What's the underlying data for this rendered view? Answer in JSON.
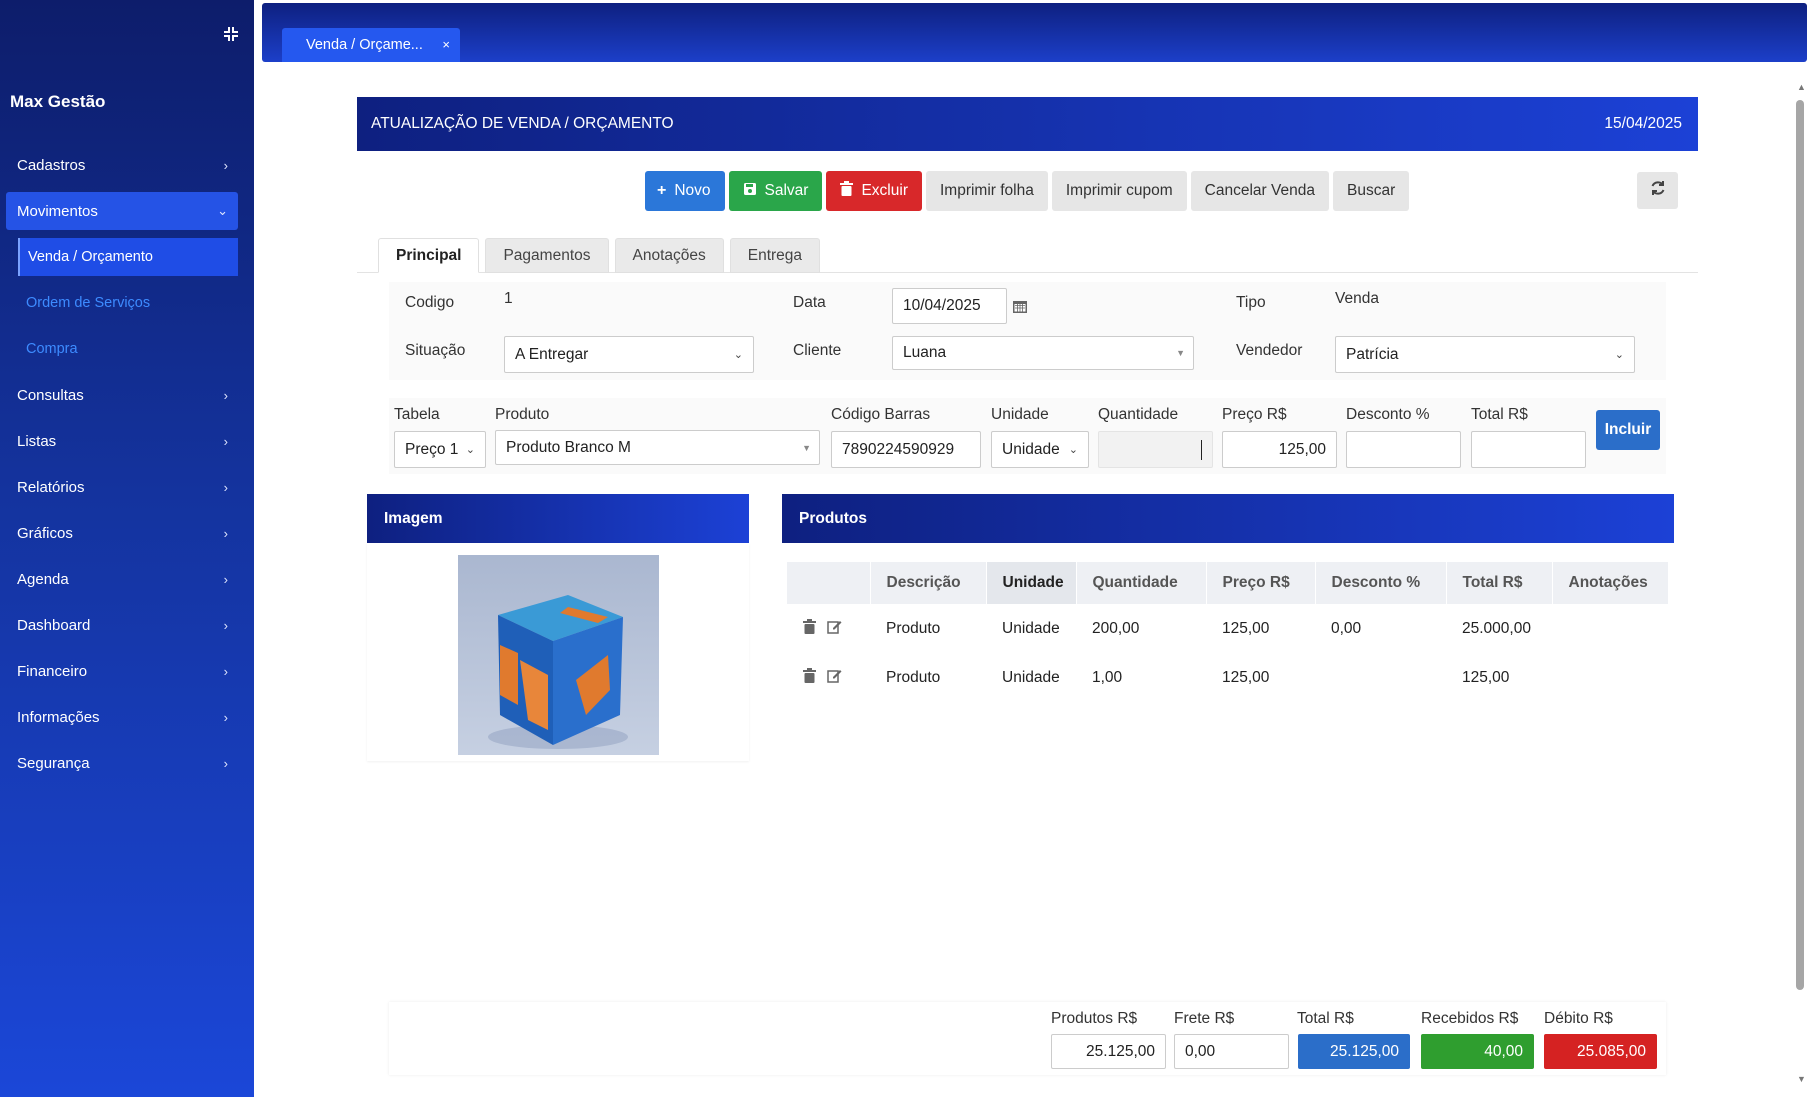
{
  "app": {
    "brand": "Max Gestão"
  },
  "sidebar": {
    "items": [
      {
        "label": "Cadastros"
      },
      {
        "label": "Movimentos"
      },
      {
        "label": "Consultas"
      },
      {
        "label": "Listas"
      },
      {
        "label": "Relatórios"
      },
      {
        "label": "Gráficos"
      },
      {
        "label": "Agenda"
      },
      {
        "label": "Dashboard"
      },
      {
        "label": "Financeiro"
      },
      {
        "label": "Informações"
      },
      {
        "label": "Segurança"
      }
    ],
    "sub_items": [
      {
        "label": "Venda / Orçamento"
      },
      {
        "label": "Ordem de Serviços"
      },
      {
        "label": "Compra"
      }
    ]
  },
  "tabs": {
    "open_tab": "Venda / Orçame...",
    "close": "×"
  },
  "header": {
    "title": "ATUALIZAÇÃO DE VENDA / ORÇAMENTO",
    "date": "15/04/2025"
  },
  "toolbar": {
    "novo": "Novo",
    "salvar": "Salvar",
    "excluir": "Excluir",
    "imprimir_folha": "Imprimir folha",
    "imprimir_cupom": "Imprimir cupom",
    "cancelar_venda": "Cancelar Venda",
    "buscar": "Buscar"
  },
  "section_tabs": [
    "Principal",
    "Pagamentos",
    "Anotações",
    "Entrega"
  ],
  "form": {
    "codigo_label": "Codigo",
    "codigo_value": "1",
    "data_label": "Data",
    "data_value": "10/04/2025",
    "tipo_label": "Tipo",
    "tipo_value": "Venda",
    "situacao_label": "Situação",
    "situacao_value": "A Entregar",
    "cliente_label": "Cliente",
    "cliente_value": "Luana",
    "vendedor_label": "Vendedor",
    "vendedor_value": "Patrícia"
  },
  "product_entry": {
    "tabela_label": "Tabela",
    "tabela_value": "Preço 1",
    "produto_label": "Produto",
    "produto_value": "Produto Branco M",
    "codigo_barras_label": "Código Barras",
    "codigo_barras_value": "7890224590929",
    "unidade_label": "Unidade",
    "unidade_value": "Unidade",
    "quantidade_label": "Quantidade",
    "quantidade_value": "",
    "preco_label": "Preço R$",
    "preco_value": "125,00",
    "desconto_label": "Desconto %",
    "desconto_value": "",
    "total_label": "Total R$",
    "total_value": "",
    "incluir": "Incluir"
  },
  "image_panel": {
    "title": "Imagem"
  },
  "products_panel": {
    "title": "Produtos",
    "columns": [
      "Descrição",
      "Unidade",
      "Quantidade",
      "Preço R$",
      "Desconto %",
      "Total R$",
      "Anotações"
    ],
    "rows": [
      {
        "descricao": "Produto",
        "unidade": "Unidade",
        "quantidade": "200,00",
        "preco": "125,00",
        "desconto": "0,00",
        "total": "25.000,00",
        "anotacoes": ""
      },
      {
        "descricao": "Produto",
        "unidade": "Unidade",
        "quantidade": "1,00",
        "preco": "125,00",
        "desconto": "",
        "total": "125,00",
        "anotacoes": ""
      }
    ]
  },
  "totals": {
    "produtos_label": "Produtos R$",
    "produtos_value": "25.125,00",
    "frete_label": "Frete R$",
    "frete_value": "0,00",
    "total_label": "Total R$",
    "total_value": "25.125,00",
    "recebidos_label": "Recebidos R$",
    "recebidos_value": "40,00",
    "debito_label": "Débito R$",
    "debito_value": "25.085,00"
  },
  "colors": {
    "accent_blue": "#2b6ec9",
    "success": "#2f9e2f",
    "danger": "#d52222",
    "sidebar_top": "#0d1d6b",
    "sidebar_bottom": "#1b47d8"
  }
}
